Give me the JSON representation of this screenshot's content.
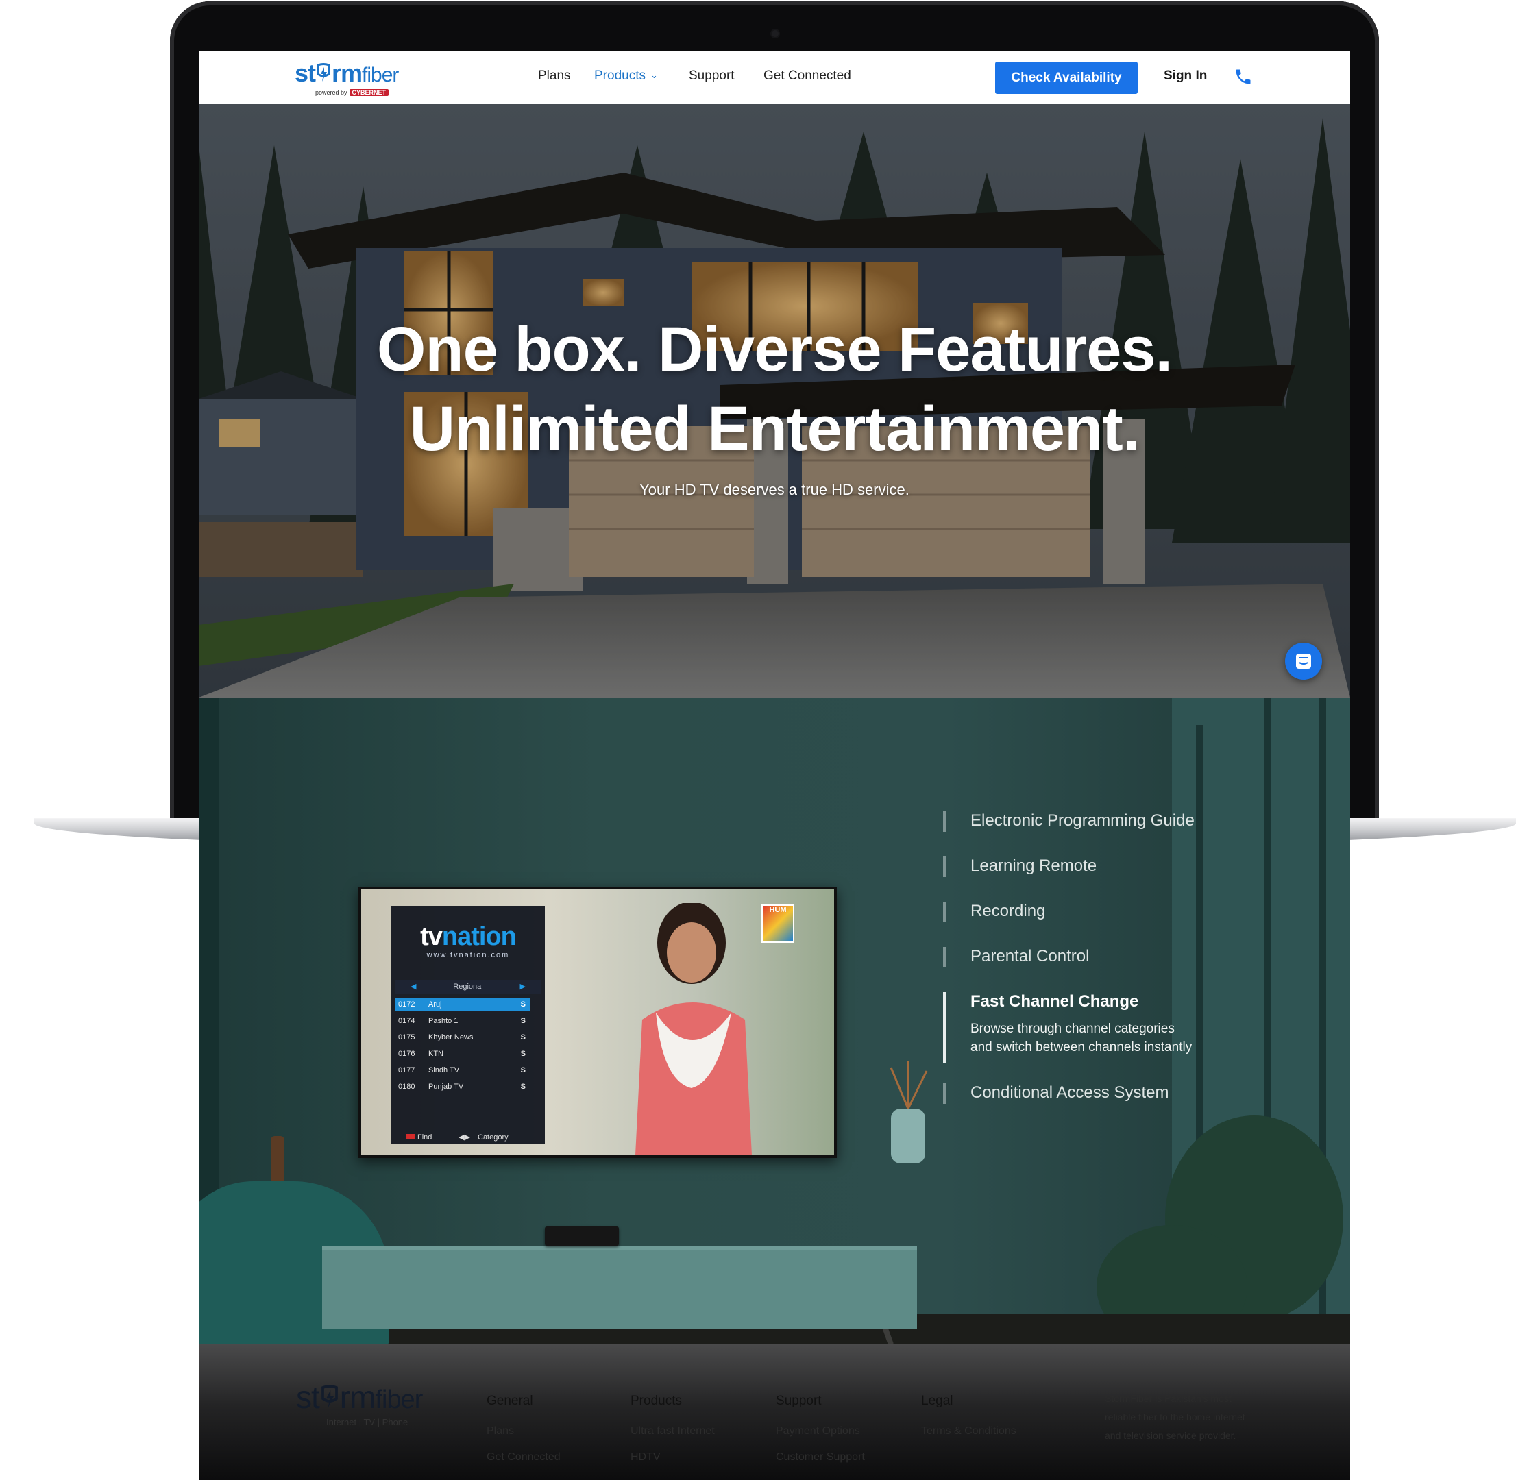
{
  "header": {
    "logo_word_bold": "st",
    "logo_word_rest": "rm",
    "logo_word_light": "fiber",
    "logo_powered_by": "powered by",
    "logo_powered_brand": "CYBERNET",
    "nav": [
      {
        "label": "Plans",
        "active": false
      },
      {
        "label": "Products",
        "active": true
      },
      {
        "label": "Support",
        "active": false
      },
      {
        "label": "Get Connected",
        "active": false
      }
    ],
    "cta_label": "Check Availability",
    "signin_label": "Sign In",
    "accent_color": "#1a73e8"
  },
  "hero": {
    "title_line1": "One box. Diverse Features.",
    "title_line2": "Unlimited Entertainment.",
    "subtitle": "Your HD TV deserves a true HD service."
  },
  "tv_screen": {
    "brand_tv": "tv",
    "brand_nation": "nation",
    "url": "www.tvnation.com",
    "category": "Regional",
    "channels": [
      {
        "number": "0172",
        "name": "Aruj",
        "selected": true
      },
      {
        "number": "0174",
        "name": "Pashto 1",
        "selected": false
      },
      {
        "number": "0175",
        "name": "Khyber News",
        "selected": false
      },
      {
        "number": "0176",
        "name": "KTN",
        "selected": false
      },
      {
        "number": "0177",
        "name": "Sindh TV",
        "selected": false
      },
      {
        "number": "0180",
        "name": "Punjab TV",
        "selected": false
      }
    ],
    "channel_badge": "S",
    "footer_find": "Find",
    "footer_category": "Category",
    "channel_logo": "HUM"
  },
  "features": {
    "items": [
      {
        "label": "Electronic Programming Guide",
        "active": false
      },
      {
        "label": "Learning Remote",
        "active": false
      },
      {
        "label": "Recording",
        "active": false
      },
      {
        "label": "Parental Control",
        "active": false
      },
      {
        "label": "Fast Channel Change",
        "active": true
      },
      {
        "label": "Conditional Access System",
        "active": false
      }
    ],
    "active_description_line1": "Browse through channel categories",
    "active_description_line2": "and switch between channels instantly"
  },
  "footer": {
    "logo_word_bold": "st",
    "logo_word_rest": "rm",
    "logo_word_light": "fiber",
    "tagline": "Internet | TV | Phone",
    "columns": [
      {
        "heading": "General",
        "links": [
          "Plans",
          "Get Connected"
        ]
      },
      {
        "heading": "Products",
        "links": [
          "Ultra fast Internet",
          "HDTV"
        ]
      },
      {
        "heading": "Support",
        "links": [
          "Payment Options",
          "Customer Support"
        ]
      },
      {
        "heading": "Legal",
        "links": [
          "Terms & Conditions"
        ]
      }
    ],
    "about": "StormFiber is Pakistan's most reliable fiber to the home internet and television service provider."
  }
}
